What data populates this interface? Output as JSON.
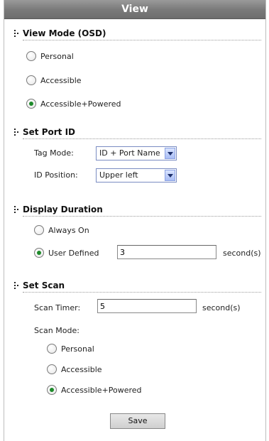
{
  "title": "View",
  "view_mode": {
    "heading": "View Mode (OSD)",
    "options": [
      {
        "label": "Personal",
        "selected": false
      },
      {
        "label": "Accessible",
        "selected": false
      },
      {
        "label": "Accessible+Powered",
        "selected": true
      }
    ]
  },
  "port_id": {
    "heading": "Set Port ID",
    "tag_mode_label": "Tag Mode:",
    "tag_mode_value": "ID + Port Name",
    "position_label": "ID Position:",
    "position_value": "Upper left"
  },
  "display_duration": {
    "heading": "Display Duration",
    "always_on_label": "Always On",
    "always_on_selected": false,
    "user_defined_label": "User Defined",
    "user_defined_selected": true,
    "user_defined_value": "3",
    "unit": "second(s)"
  },
  "scan": {
    "heading": "Set Scan",
    "timer_label": "Scan Timer:",
    "timer_value": "5",
    "unit": "second(s)",
    "mode_label": "Scan Mode:",
    "options": [
      {
        "label": "Personal",
        "selected": false
      },
      {
        "label": "Accessible",
        "selected": false
      },
      {
        "label": "Accessible+Powered",
        "selected": true
      }
    ]
  },
  "save_label": "Save",
  "colors": {
    "title_bg": "#7b7b7b",
    "radio_selected": "#1d8a2a",
    "select_border": "#7a8cc2"
  }
}
